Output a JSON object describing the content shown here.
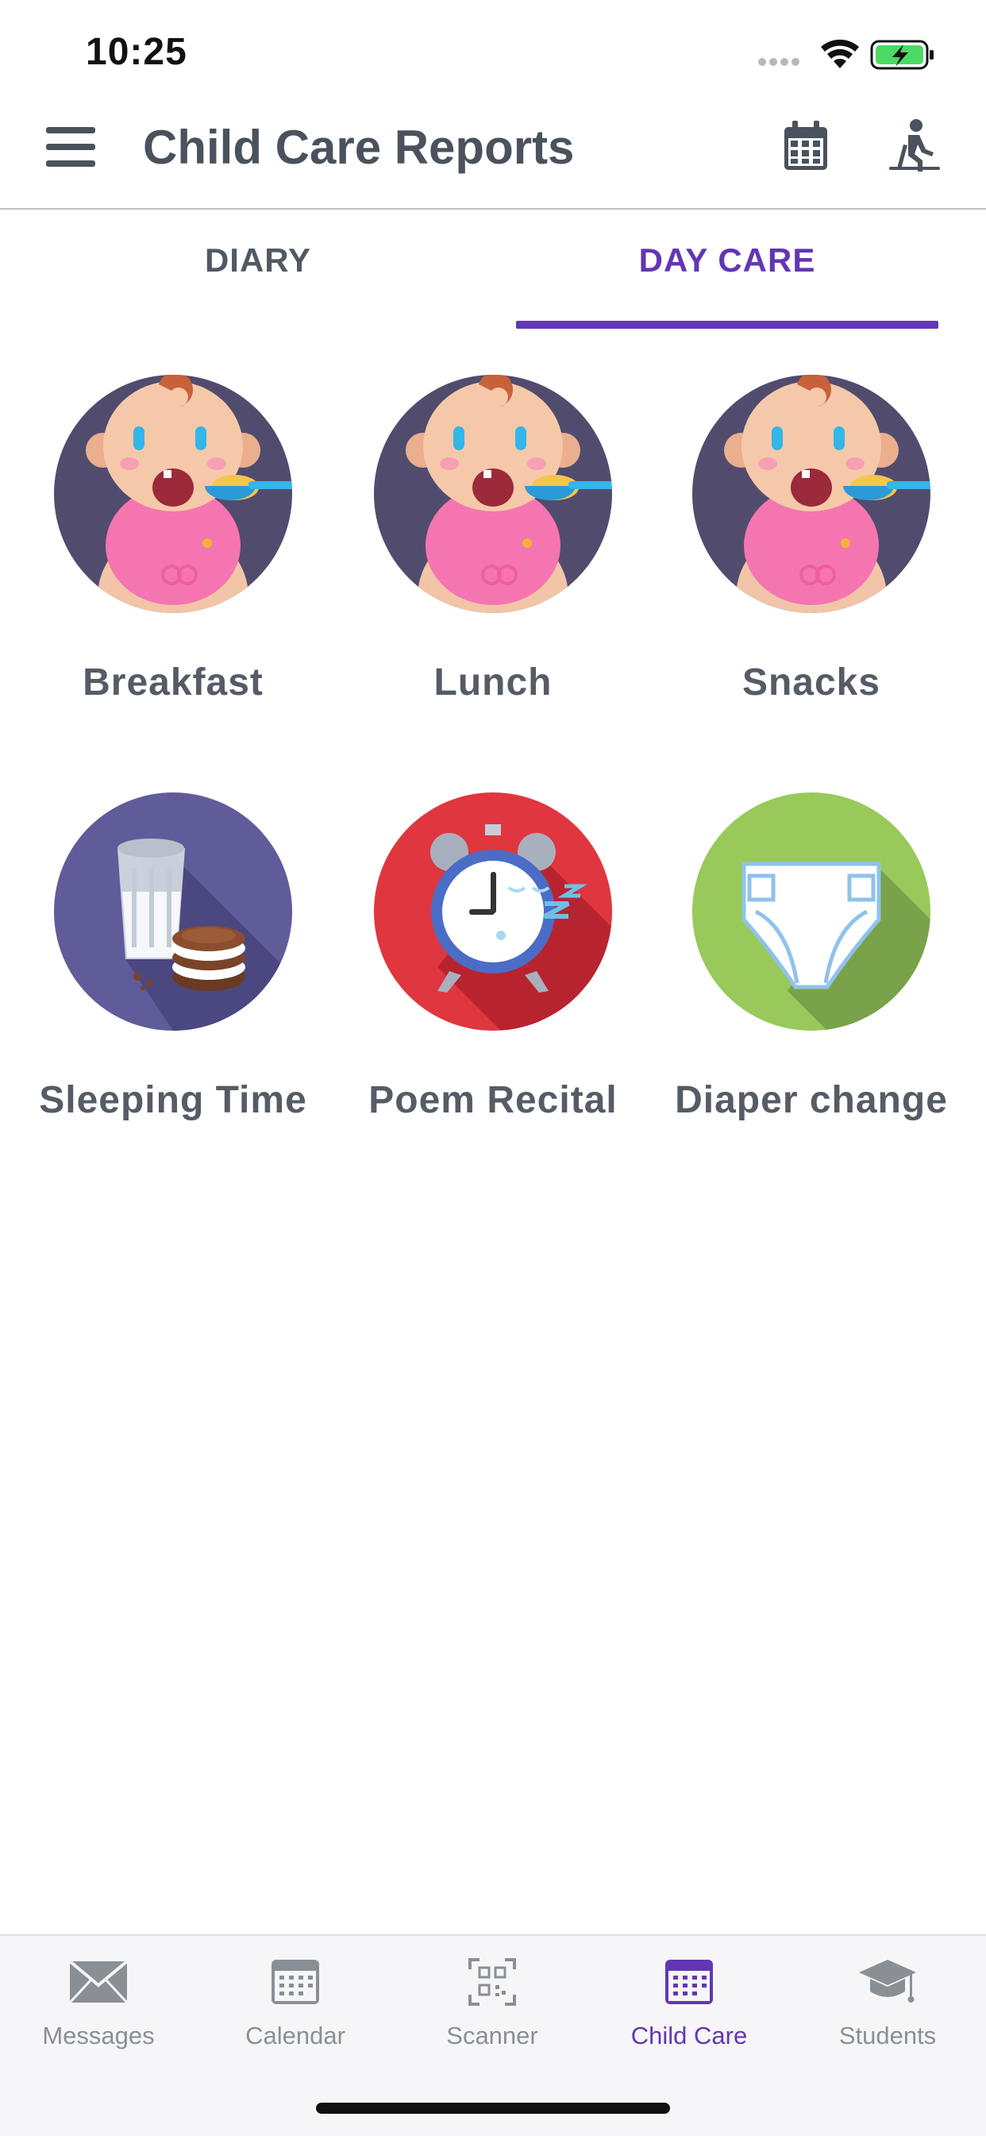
{
  "status": {
    "time": "10:25"
  },
  "header": {
    "title": "Child Care Reports",
    "menu_icon": "hamburger-menu-icon",
    "calendar_icon": "calendar-icon",
    "activity_icon": "activity-icon"
  },
  "tabs": [
    {
      "label": "DIARY",
      "active": false
    },
    {
      "label": "DAY CARE",
      "active": true
    }
  ],
  "activities": [
    {
      "label": "Breakfast",
      "icon": "baby-feeding-icon"
    },
    {
      "label": "Lunch",
      "icon": "baby-feeding-icon"
    },
    {
      "label": "Snacks",
      "icon": "baby-feeding-icon"
    },
    {
      "label": "Sleeping Time",
      "icon": "milk-and-cookies-icon"
    },
    {
      "label": "Poem Recital",
      "icon": "alarm-clock-icon"
    },
    {
      "label": "Diaper change",
      "icon": "diaper-icon"
    }
  ],
  "bottom_nav": [
    {
      "label": "Messages",
      "icon": "envelope-icon",
      "active": false
    },
    {
      "label": "Calendar",
      "icon": "calendar-icon",
      "active": false
    },
    {
      "label": "Scanner",
      "icon": "qr-scanner-icon",
      "active": false
    },
    {
      "label": "Child Care",
      "icon": "calendar-icon",
      "active": true
    },
    {
      "label": "Students",
      "icon": "graduation-cap-icon",
      "active": false
    }
  ],
  "colors": {
    "accent": "#6336b4",
    "text_dark": "#4a525d",
    "nav_inactive": "#8a8f96",
    "feeding_bg": "#514c6e",
    "milk_bg": "#605c9a",
    "clock_bg": "#e0363f",
    "diaper_bg": "#98c95a"
  }
}
